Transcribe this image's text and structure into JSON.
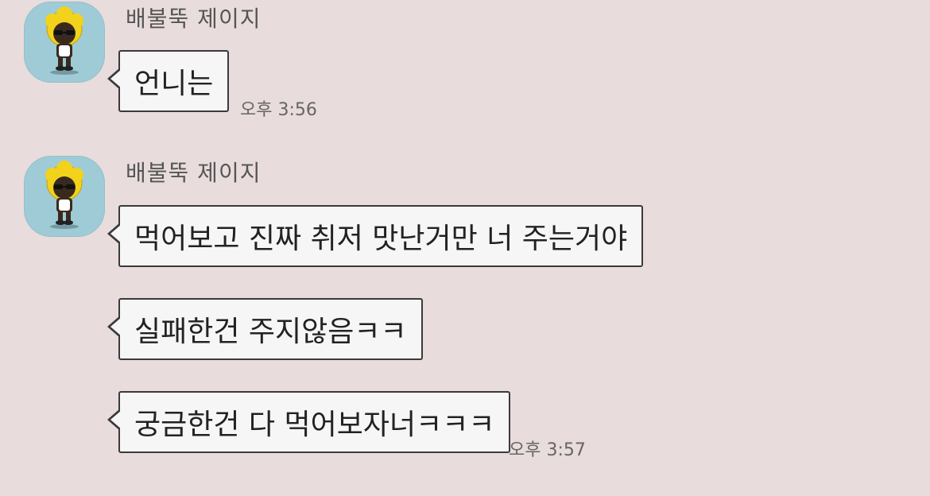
{
  "groups": [
    {
      "sender": "배불뚝 제이지",
      "avatar_icon": "character-avatar-icon",
      "messages": [
        {
          "text": "언니는",
          "time": "오후 3:56"
        }
      ]
    },
    {
      "sender": "배불뚝 제이지",
      "avatar_icon": "character-avatar-icon",
      "messages": [
        {
          "text": "먹어보고 진짜 취저 맛난거만 너 주는거야"
        },
        {
          "text": "실패한건 주지않음ㅋㅋ"
        },
        {
          "text": "궁금한건 다 먹어보자너ㅋㅋㅋ",
          "time": "오후 3:57"
        }
      ]
    }
  ],
  "colors": {
    "background": "#e9dcdc",
    "avatar_bg": "#9ecbd6",
    "bubble_bg": "#f6f6f6",
    "bubble_border": "#3a3a3a"
  }
}
